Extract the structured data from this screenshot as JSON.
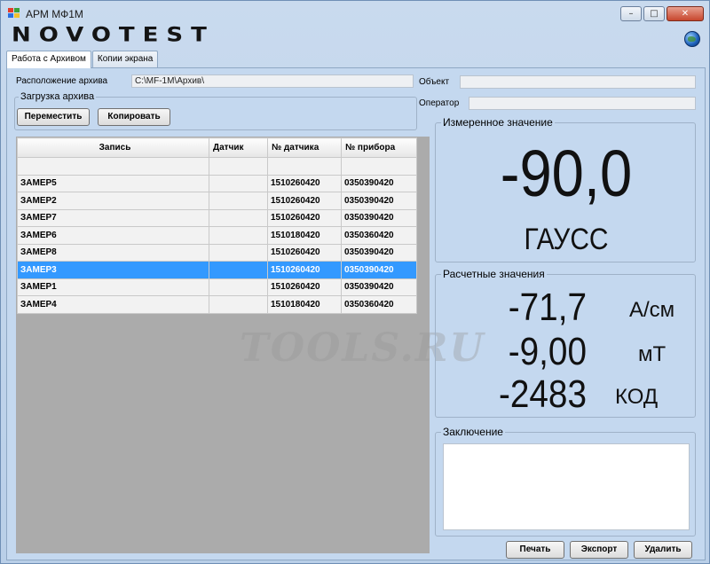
{
  "window": {
    "title": "АРМ МФ1М",
    "brand": "NOVOTEST",
    "controls": {
      "minimize": "–",
      "maximize": "□",
      "close": "✕"
    }
  },
  "tabs": [
    {
      "label": "Работа с Архивом",
      "active": true
    },
    {
      "label": "Копии экрана",
      "active": false
    }
  ],
  "archive": {
    "location_label": "Расположение архива",
    "location_value": "C:\\MF-1M\\Архив\\",
    "load_group_title": "Загрузка архива",
    "move_button": "Переместить",
    "copy_button": "Копировать"
  },
  "meta": {
    "object_label": "Объект",
    "object_value": "",
    "operator_label": "Оператор",
    "operator_value": ""
  },
  "table": {
    "columns": [
      "Запись",
      "Датчик",
      "№ датчика",
      "№ прибора"
    ],
    "rows": [
      {
        "record": "",
        "sensor": "",
        "sensor_no": "",
        "device_no": "",
        "selected": false
      },
      {
        "record": "ЗАМЕР5",
        "sensor": "",
        "sensor_no": "1510260420",
        "device_no": "0350390420",
        "selected": false
      },
      {
        "record": "ЗАМЕР2",
        "sensor": "",
        "sensor_no": "1510260420",
        "device_no": "0350390420",
        "selected": false
      },
      {
        "record": "ЗАМЕР7",
        "sensor": "",
        "sensor_no": "1510260420",
        "device_no": "0350390420",
        "selected": false
      },
      {
        "record": "ЗАМЕР6",
        "sensor": "",
        "sensor_no": "1510180420",
        "device_no": "0350360420",
        "selected": false
      },
      {
        "record": "ЗАМЕР8",
        "sensor": "",
        "sensor_no": "1510260420",
        "device_no": "0350390420",
        "selected": false
      },
      {
        "record": "ЗАМЕР3",
        "sensor": "",
        "sensor_no": "1510260420",
        "device_no": "0350390420",
        "selected": true
      },
      {
        "record": "ЗАМЕР1",
        "sensor": "",
        "sensor_no": "1510260420",
        "device_no": "0350390420",
        "selected": false
      },
      {
        "record": "ЗАМЕР4",
        "sensor": "",
        "sensor_no": "1510180420",
        "device_no": "0350360420",
        "selected": false
      }
    ]
  },
  "measured": {
    "title": "Измеренное значение",
    "value": "-90,0",
    "unit": "ГАУСС"
  },
  "calculated": {
    "title": "Расчетные значения",
    "items": [
      {
        "value": "-71,7",
        "unit": "А/см"
      },
      {
        "value": "-9,00",
        "unit": "мТ"
      },
      {
        "value": "-2483",
        "unit": "КОД"
      }
    ]
  },
  "conclusion": {
    "title": "Заключение",
    "text": ""
  },
  "actions": {
    "print": "Печать",
    "export": "Экспорт",
    "delete": "Удалить"
  },
  "watermark": "TOOLS.RU",
  "colors": {
    "selection": "#3399ff",
    "window_bg": "#c4d8ef"
  }
}
